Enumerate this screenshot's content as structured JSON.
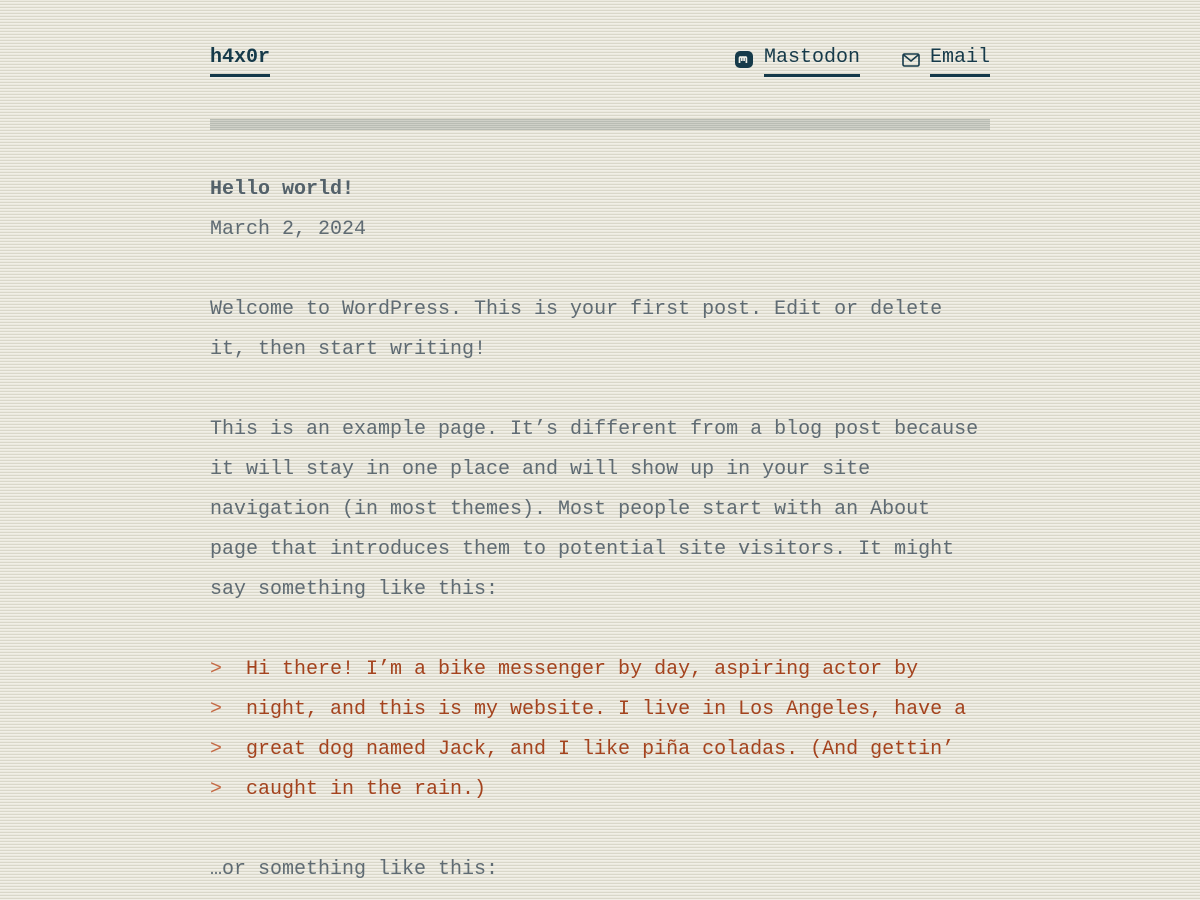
{
  "header": {
    "site_title": "h4x0r",
    "nav": [
      {
        "label": "Mastodon",
        "icon": "mastodon-icon"
      },
      {
        "label": "Email",
        "icon": "envelope-icon"
      }
    ]
  },
  "post": {
    "title": "Hello world!",
    "date": "March 2, 2024",
    "paragraph_1": "Welcome to WordPress. This is your first post. Edit or delete it, then start writing!",
    "paragraph_2": "This is an example page. It’s different from a blog post because it will stay in one place and will show up in your site navigation (in most themes). Most people start with an About page that introduces them to potential site visitors. It might say something like this:",
    "quote_marker": ">",
    "quote_lines": [
      "Hi there! I’m a bike messenger by day, aspiring actor by",
      "night, and this is my website. I live in Los Angeles, have a",
      "great dog named Jack, and I like piña coladas. (And gettin’",
      "caught in the rain.)"
    ],
    "paragraph_3": "…or something like this:"
  },
  "colors": {
    "link": "#163a4a",
    "text": "#5f6b73",
    "quote": "#a4431e"
  }
}
